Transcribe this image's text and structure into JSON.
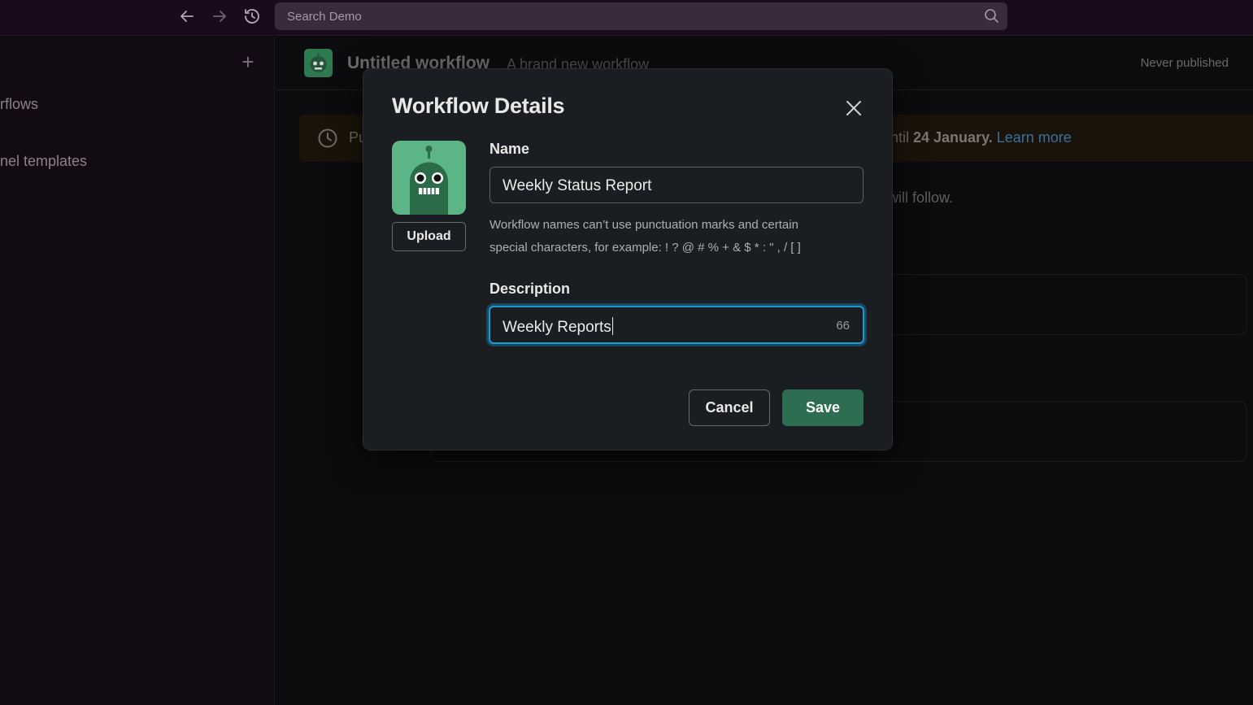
{
  "topbar": {
    "search_placeholder": "Search Demo",
    "back_icon": "arrow-left-icon",
    "forward_icon": "arrow-right-icon",
    "history_icon": "history-icon",
    "search_icon": "search-icon"
  },
  "sidebar": {
    "items": [
      {
        "label": "rflows"
      },
      {
        "label": "nel templates"
      }
    ]
  },
  "workflow": {
    "title": "Untitled workflow",
    "subtitle": "A brand new workflow",
    "status": "Never published"
  },
  "banner": {
    "left_text": "Pu",
    "right_prefix": "ntil ",
    "right_bold": "24 January.",
    "link": "Learn more"
  },
  "background": {
    "follow_text": "will follow."
  },
  "modal": {
    "title": "Workflow Details",
    "upload_label": "Upload",
    "name_label": "Name",
    "name_value": "Weekly Status Report",
    "help_text": "Workflow names can’t use punctuation marks and certain special characters, for example: ! ? @ # % + & $ * : \" , / [ ]",
    "description_label": "Description",
    "description_value": "Weekly Reports",
    "description_counter": "66",
    "cancel_label": "Cancel",
    "save_label": "Save"
  },
  "colors": {
    "accent_focus": "#1d9bd1",
    "save_button": "#2d6e52",
    "avatar_bg": "#5bb587",
    "link": "#3a6fa2"
  }
}
